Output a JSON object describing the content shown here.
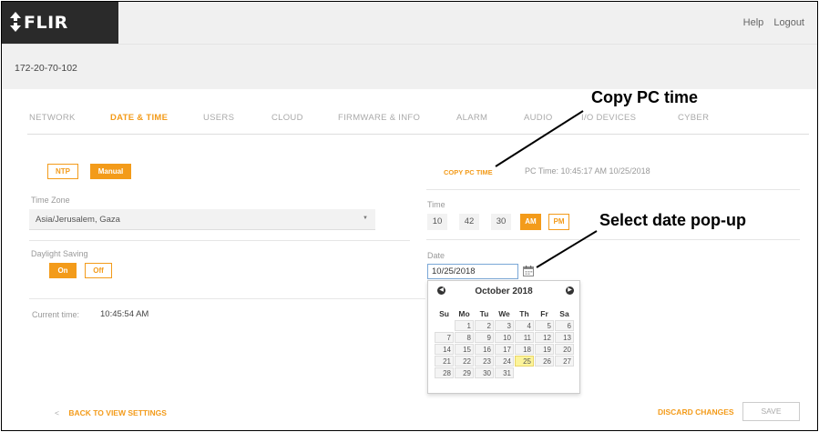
{
  "header": {
    "logo_text": "FLIR",
    "help_label": "Help",
    "logout_label": "Logout"
  },
  "device": {
    "name": "172-20-70-102"
  },
  "tabs": [
    {
      "label": "NETWORK",
      "active": false
    },
    {
      "label": "DATE & TIME",
      "active": true
    },
    {
      "label": "USERS",
      "active": false
    },
    {
      "label": "CLOUD",
      "active": false
    },
    {
      "label": "FIRMWARE & INFO",
      "active": false
    },
    {
      "label": "ALARM",
      "active": false
    },
    {
      "label": "AUDIO",
      "active": false
    },
    {
      "label": "I/O DEVICES",
      "active": false
    },
    {
      "label": "CYBER",
      "active": false
    }
  ],
  "left": {
    "ntp_label": "NTP",
    "manual_label": "Manual",
    "time_zone_label": "Time Zone",
    "time_zone_value": "Asia/Jerusalem, Gaza",
    "daylight_label": "Daylight Saving",
    "on_label": "On",
    "off_label": "Off",
    "current_time_label": "Current time:",
    "current_time_value": "10:45:54 AM"
  },
  "right": {
    "copy_pc_time_label": "COPY PC TIME",
    "pc_time_text": "PC Time: 10:45:17 AM 10/25/2018",
    "time_label": "Time",
    "hour": "10",
    "minute": "42",
    "second": "30",
    "am_label": "AM",
    "pm_label": "PM",
    "date_label": "Date",
    "date_value": "10/25/2018"
  },
  "calendar": {
    "title": "October 2018",
    "prev_glyph": "◀",
    "next_glyph": "▶",
    "weekdays": [
      "Su",
      "Mo",
      "Tu",
      "We",
      "Th",
      "Fr",
      "Sa"
    ],
    "weeks": [
      [
        "",
        "1",
        "2",
        "3",
        "4",
        "5",
        "6"
      ],
      [
        "7",
        "8",
        "9",
        "10",
        "11",
        "12",
        "13"
      ],
      [
        "14",
        "15",
        "16",
        "17",
        "18",
        "19",
        "20"
      ],
      [
        "21",
        "22",
        "23",
        "24",
        "25",
        "26",
        "27"
      ],
      [
        "28",
        "29",
        "30",
        "31",
        "",
        "",
        ""
      ]
    ],
    "selected_day": "25"
  },
  "footer": {
    "back_chevron": "<",
    "back_label": "BACK TO VIEW SETTINGS",
    "discard_label": "DISCARD CHANGES",
    "save_label": "SAVE"
  },
  "annotations": {
    "copy_pc_time": "Copy PC time",
    "select_date_popup": "Select date pop-up"
  },
  "colors": {
    "accent": "#f39b1a",
    "header_bg": "#f0f0f0",
    "logo_bg": "#2a2a2a",
    "today_highlight": "#fcf49a"
  }
}
